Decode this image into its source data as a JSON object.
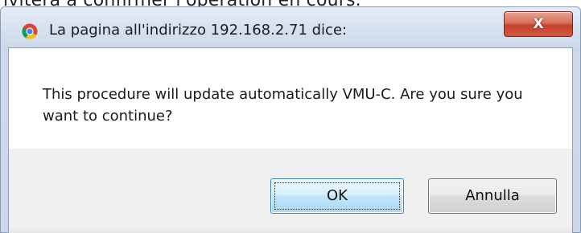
{
  "background": {
    "text": "ivitera a confirmer l'operation en cours."
  },
  "dialog": {
    "title": "La pagina all'indirizzo 192.168.2.71 dice:",
    "title_icon": "chrome-icon",
    "close_icon": "close-icon",
    "close_glyph": "X",
    "message": "This procedure will update automatically VMU-C. Are you sure you want to continue?",
    "ok_label": "OK",
    "cancel_label": "Annulla"
  },
  "colors": {
    "close_button": "#c5422c",
    "ok_button_border": "#3c7fb1",
    "client_bg": "#f0f0f0",
    "frame": "#cfdbec"
  }
}
